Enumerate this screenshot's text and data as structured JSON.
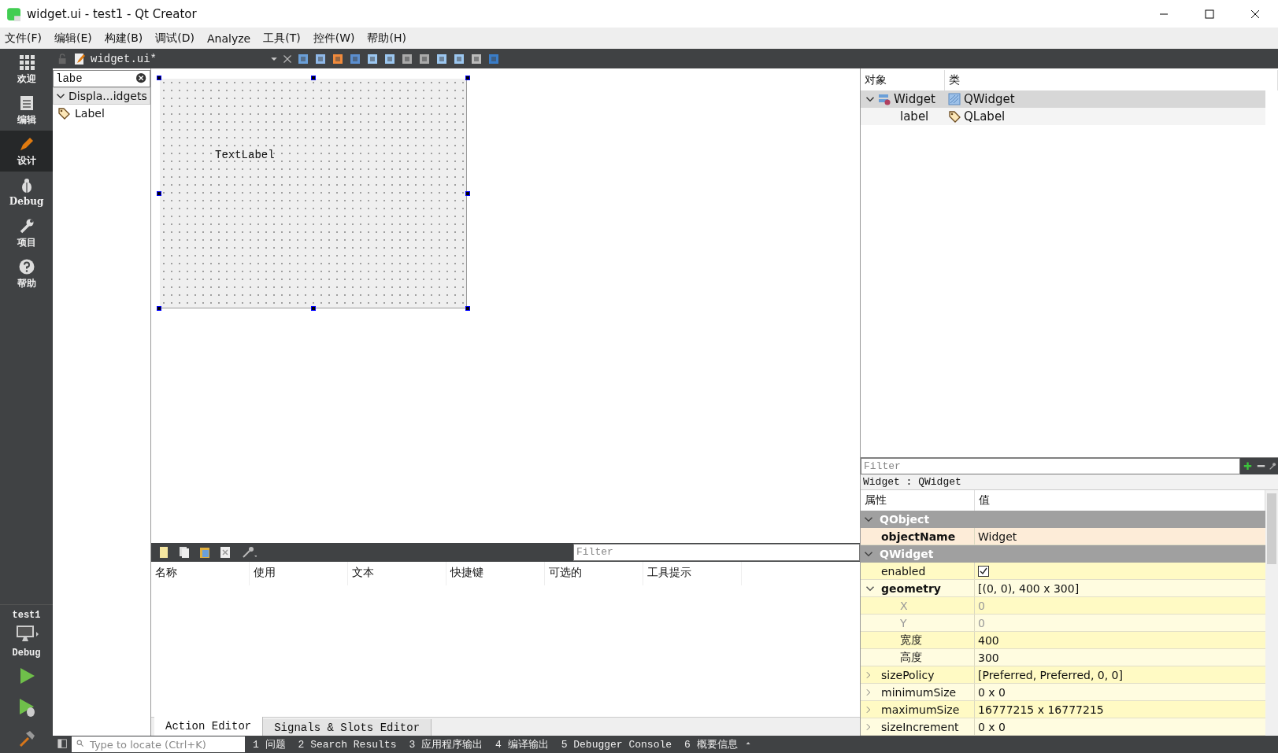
{
  "window": {
    "title": "widget.ui - test1 - Qt Creator"
  },
  "menu": [
    "文件(F)",
    "编辑(E)",
    "构建(B)",
    "调试(D)",
    "Analyze",
    "工具(T)",
    "控件(W)",
    "帮助(H)"
  ],
  "mode_bar": {
    "items": [
      {
        "kind": "welcome",
        "label": "欢迎",
        "selected": false
      },
      {
        "kind": "edit",
        "label": "编辑",
        "selected": false
      },
      {
        "kind": "design",
        "label": "设计",
        "selected": true
      },
      {
        "kind": "debug",
        "label": "Debug",
        "selected": false
      },
      {
        "kind": "projects",
        "label": "项目",
        "selected": false
      },
      {
        "kind": "help",
        "label": "帮助",
        "selected": false
      }
    ],
    "kit": {
      "project": "test1",
      "config": "Debug"
    }
  },
  "editor_toolbar": {
    "file": "widget.ui*"
  },
  "widget_box": {
    "search": "labe",
    "categories": [
      {
        "label": "Displa...idgets",
        "expanded": true,
        "children": [
          {
            "label": "Label"
          }
        ]
      }
    ]
  },
  "form": {
    "labels": [
      "TextLabel"
    ]
  },
  "object_inspector": {
    "columns": [
      "对象",
      "类"
    ],
    "rows": [
      {
        "object": "Widget",
        "class": "QWidget",
        "selected": true,
        "expanded": true,
        "children": [
          {
            "object": "label",
            "class": "QLabel",
            "selected": false
          }
        ]
      }
    ]
  },
  "property_editor": {
    "filter_placeholder": "Filter",
    "context": "Widget : QWidget",
    "columns": [
      "属性",
      "值"
    ],
    "groups": [
      {
        "name": "QObject",
        "expanded": true,
        "rows": [
          {
            "kind": "text",
            "name": "objectName",
            "value": "Widget",
            "bold": true
          }
        ]
      },
      {
        "name": "QWidget",
        "expanded": true,
        "rows": [
          {
            "kind": "checkbox",
            "name": "enabled",
            "checked": true
          },
          {
            "kind": "text",
            "name": "geometry",
            "value": "[(0, 0), 400 x 300]",
            "bold": true,
            "expanded": true,
            "children": [
              {
                "kind": "text",
                "name": "X",
                "value": "0",
                "disabled": true
              },
              {
                "kind": "text",
                "name": "Y",
                "value": "0",
                "disabled": true
              },
              {
                "kind": "text",
                "name": "宽度",
                "value": "400",
                "disabled": false
              },
              {
                "kind": "text",
                "name": "高度",
                "value": "300",
                "disabled": false
              }
            ]
          },
          {
            "kind": "text",
            "name": "sizePolicy",
            "value": "[Preferred, Preferred, 0, 0]",
            "bold": false,
            "expanded": false
          },
          {
            "kind": "text",
            "name": "minimumSize",
            "value": "0 x 0",
            "bold": false,
            "expanded": false
          },
          {
            "kind": "text",
            "name": "maximumSize",
            "value": "16777215 x 16777215",
            "bold": false,
            "expanded": false
          },
          {
            "kind": "text",
            "name": "sizeIncrement",
            "value": "0 x 0",
            "bold": false,
            "expanded": false
          }
        ]
      }
    ]
  },
  "action_editor": {
    "filter_placeholder": "Filter",
    "columns": [
      "名称",
      "使用",
      "文本",
      "快捷键",
      "可选的",
      "工具提示"
    ],
    "tabs": [
      {
        "label": "Action Editor",
        "selected": true
      },
      {
        "label": "Signals & Slots Editor",
        "selected": false
      }
    ]
  },
  "status_bar": {
    "locate_placeholder": "Type to locate (Ctrl+K)",
    "panes": [
      "1 问题",
      "2 Search Results",
      "3 应用程序输出",
      "4 编译输出",
      "5 Debugger Console",
      "6 概要信息"
    ]
  }
}
